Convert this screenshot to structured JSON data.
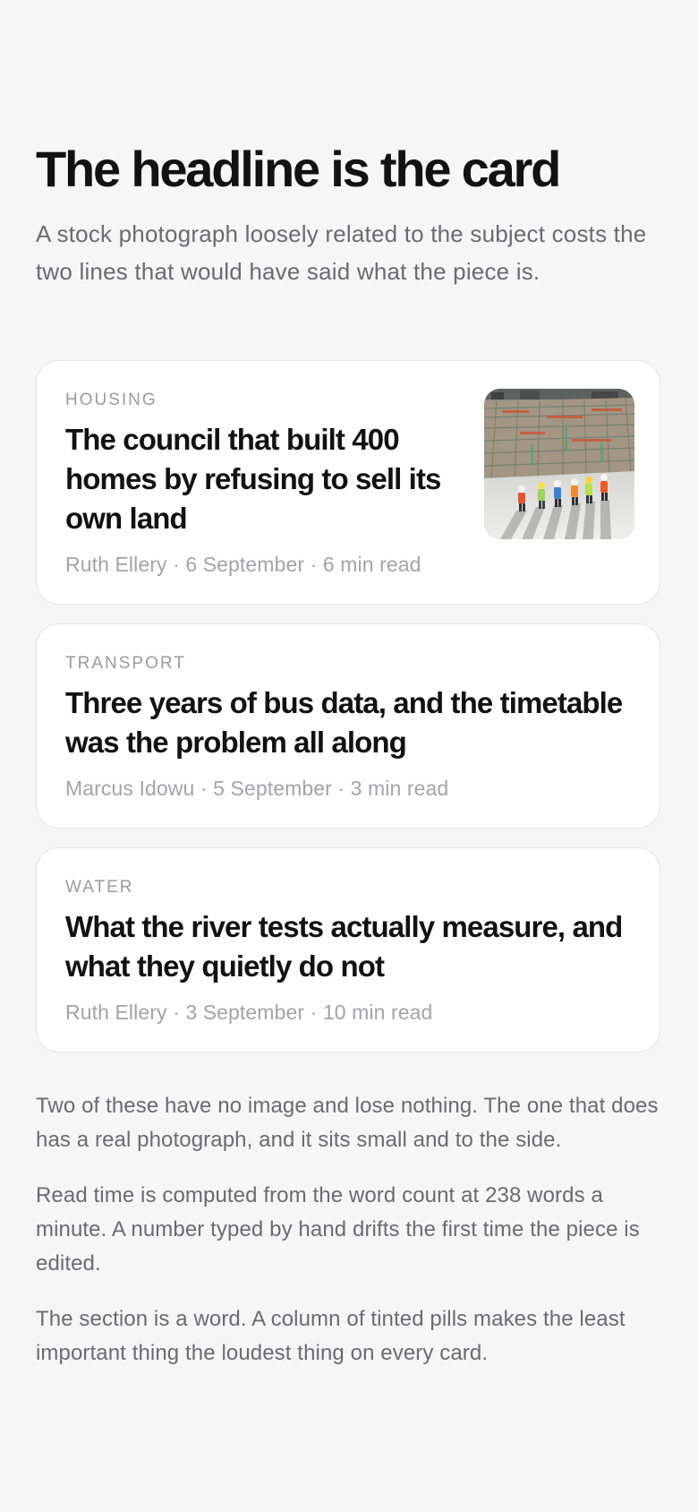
{
  "page": {
    "title": "The headline is the card",
    "lede": "A stock photograph loosely related to the subject costs the two lines that would have said what the piece is."
  },
  "articles": [
    {
      "section": "HOUSING",
      "headline": "The council that built 400 homes by refusing to sell its own land",
      "byline": "Ruth Ellery · 6 September · 6 min read",
      "image": "construction-site-workers-photo"
    },
    {
      "section": "TRANSPORT",
      "headline": "Three years of bus data, and the timetable was the problem all along",
      "byline": "Marcus Idowu · 5 September · 3 min read"
    },
    {
      "section": "WATER",
      "headline": "What the river tests actually measure, and what they quietly do not",
      "byline": "Ruth Ellery · 3 September · 10 min read"
    }
  ],
  "notes": [
    "Two of these have no image and lose nothing. The one that does has a real photograph, and it sits small and to the side.",
    "Read time is computed from the word count at 238 words a minute. A number typed by hand drifts the first time the piece is edited.",
    "The section is a word. A column of tinted pills makes the least important thing the loudest thing on every card."
  ],
  "colors": {
    "background": "#f6f6f6",
    "card": "#ffffff",
    "headline": "#121212",
    "muted_text": "#6b6b70",
    "meta_text": "#a3a3a8"
  }
}
